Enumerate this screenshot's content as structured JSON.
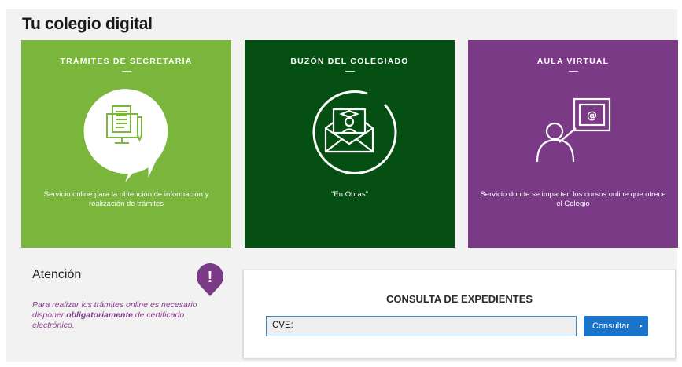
{
  "page": {
    "title": "Tu colegio digital"
  },
  "cards": [
    {
      "title": "TRÁMITES DE SECRETARÍA",
      "description": "Servicio online para la obtención de información y realización de trámites",
      "icon": "document-computer-icon",
      "color": "#7ab53c"
    },
    {
      "title": "BUZÓN DEL COLEGIADO",
      "description": "\"En Obras\"",
      "icon": "mail-graduate-icon",
      "color": "#064f12"
    },
    {
      "title": "AULA VIRTUAL",
      "description": "Servicio donde se imparten los cursos online que ofrece el Colegio",
      "icon": "teacher-board-icon",
      "color": "#7b3a85"
    }
  ],
  "atencion": {
    "title": "Atención",
    "text_before": "Para realizar los trámites online es necesario disponer ",
    "text_bold": "obligatoriamente",
    "text_after": " de certificado electrónico.",
    "badge_glyph": "!"
  },
  "consulta": {
    "title": "CONSULTA DE EXPEDIENTES",
    "input_label": "CVE:",
    "input_value": "",
    "button_label": "Consultar",
    "button_caret": "▸"
  }
}
